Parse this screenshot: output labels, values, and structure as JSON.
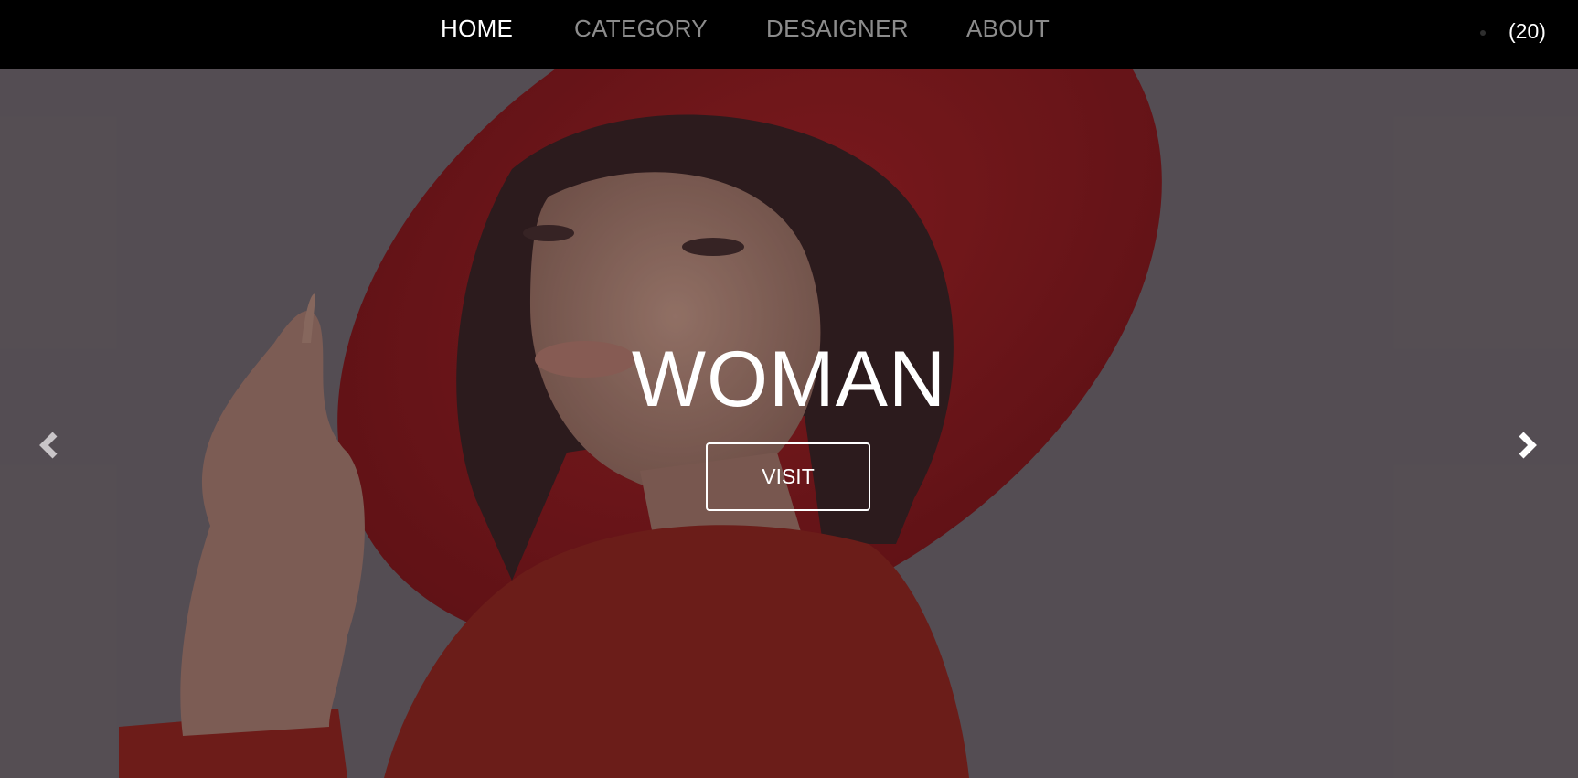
{
  "nav": {
    "links": [
      {
        "label": "HOME",
        "active": true
      },
      {
        "label": "CATEGORY",
        "active": false
      },
      {
        "label": "DESAIGNER",
        "active": false
      },
      {
        "label": "ABOUT",
        "active": false
      }
    ],
    "cart_count": "(20)"
  },
  "hero": {
    "title": "WOMAN",
    "visit_label": "VISIT",
    "prev_icon": "chevron-left-icon",
    "next_icon": "chevron-right-icon",
    "colors": {
      "background": "#5f585d",
      "hat": "#7e1517",
      "jacket": "#7a1e17",
      "skin": "#9b7566",
      "hair": "#2e1b1c"
    }
  },
  "colors": {
    "nav_bg": "#000000",
    "nav_active": "#ffffff",
    "nav_inactive": "#8c8c8c"
  }
}
